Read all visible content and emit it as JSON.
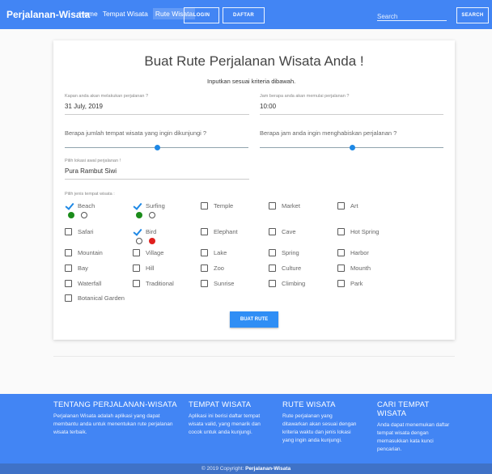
{
  "navbar": {
    "brand": "Perjalanan-Wisata",
    "links": [
      "Home",
      "Tempat Wisata",
      "Rute Wisata"
    ],
    "login": "LOGIN",
    "daftar": "DAFTAR",
    "search_placeholder": "Search",
    "search_button": "SEARCH",
    "color": "#4285f4"
  },
  "form": {
    "title": "Buat Rute Perjalanan Wisata Anda !",
    "subtitle": "Inputkan sesuai kriteria dibawah.",
    "date_label": "Kapan anda akan melakukan perjalanan ?",
    "date_value": "31 July, 2019",
    "time_label": "Jam berapa anda akan memulai perjalanan ?",
    "time_value": "10:00",
    "places_question": "Berapa jumlah tempat wisata yang ingin dikunjungi ?",
    "places_slider": 0.5,
    "hours_question": "Berapa jam anda ingin menghabiskan perjalanan ?",
    "hours_slider": 0.5,
    "start_label": "Pilih lokasi awal perjalanan !",
    "start_value": "Pura Rambut Siwi",
    "types_label": "Pilih jenis tempat wisata :",
    "types": [
      {
        "label": "Beach",
        "checked": true,
        "selected": "left"
      },
      {
        "label": "Surfing",
        "checked": true,
        "selected": "left"
      },
      {
        "label": "Temple",
        "checked": false
      },
      {
        "label": "Market",
        "checked": false
      },
      {
        "label": "Art",
        "checked": false
      },
      {
        "label": "Safari",
        "checked": false
      },
      {
        "label": "Bird",
        "checked": true,
        "selected": "right"
      },
      {
        "label": "Elephant",
        "checked": false
      },
      {
        "label": "Cave",
        "checked": false
      },
      {
        "label": "Hot Spring",
        "checked": false
      },
      {
        "label": "Mountain",
        "checked": false
      },
      {
        "label": "Village",
        "checked": false
      },
      {
        "label": "Lake",
        "checked": false
      },
      {
        "label": "Spring",
        "checked": false
      },
      {
        "label": "Harbor",
        "checked": false
      },
      {
        "label": "Bay",
        "checked": false
      },
      {
        "label": "Hill",
        "checked": false
      },
      {
        "label": "Zoo",
        "checked": false
      },
      {
        "label": "Culture",
        "checked": false
      },
      {
        "label": "Mounth",
        "checked": false
      },
      {
        "label": "Waterfall",
        "checked": false
      },
      {
        "label": "Traditional",
        "checked": false
      },
      {
        "label": "Sunrise",
        "checked": false
      },
      {
        "label": "Climbing",
        "checked": false
      },
      {
        "label": "Park",
        "checked": false
      },
      {
        "label": "Botanical Garden",
        "checked": false
      }
    ],
    "submit": "BUAT RUTE"
  },
  "footer": {
    "cols": [
      {
        "heading": "TENTANG PERJALANAN-WISATA",
        "text": "Perjalanan Wisata adalah aplikasi yang dapat membantu anda untuk menentukan rute perjalanan wisata terbaik."
      },
      {
        "heading": "TEMPAT WISATA",
        "text": "Aplikasi ini berisi daftar tempat wisata valid, yang menarik dan cocok untuk anda kunjungi."
      },
      {
        "heading": "RUTE WISATA",
        "text": "Rute perjalanan yang ditawarkan akan sesuai dengan kriteria waktu dan jenis lokasi yang ingin anda kunjungi."
      },
      {
        "heading": "CARI TEMPAT WISATA",
        "text": "Anda dapat menemukan daftar tempat wisata dengan memasukkan kata kunci pencarian."
      }
    ],
    "copyright_prefix": "© 2019 Copyright: ",
    "copyright_brand": "Perjalanan-Wisata"
  }
}
